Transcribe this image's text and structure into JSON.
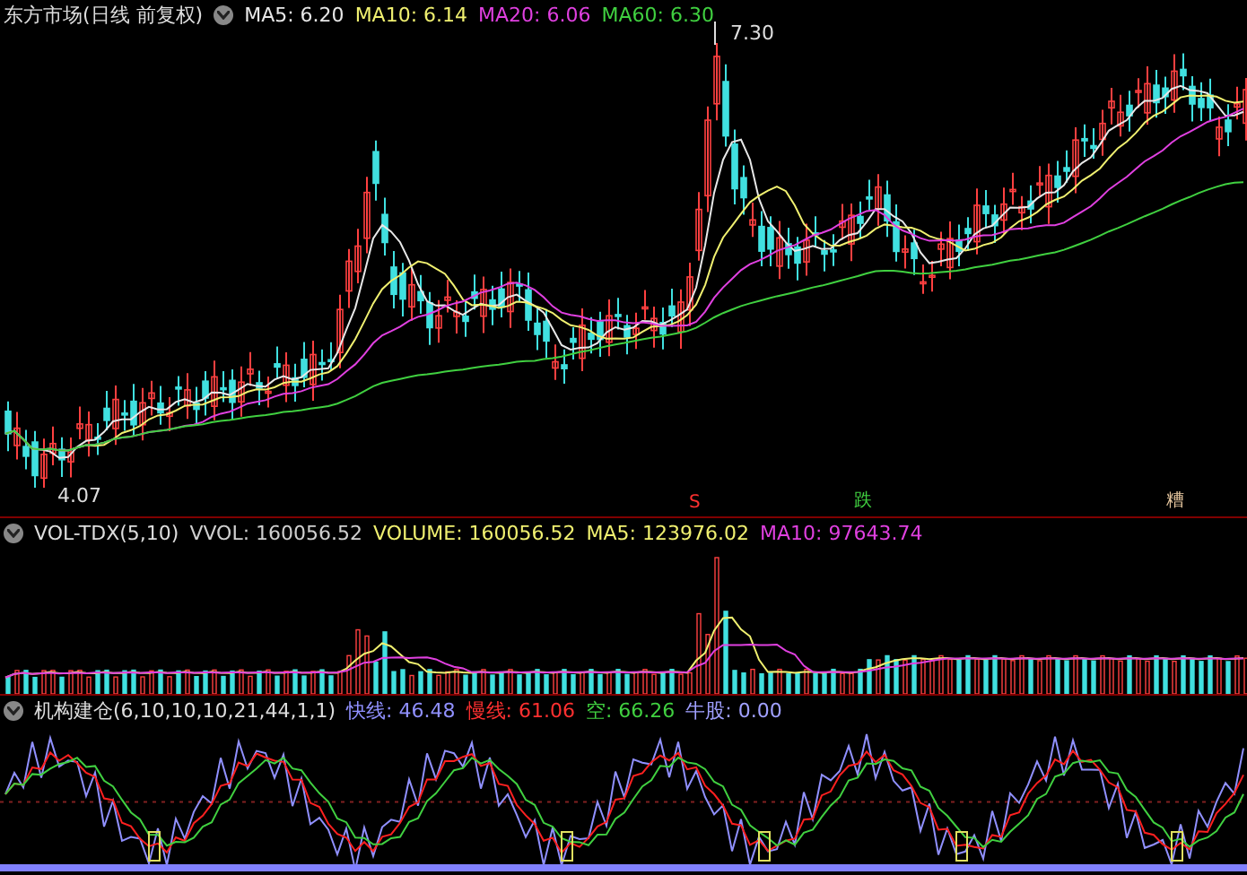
{
  "main_panel": {
    "title": "东方市场(日线 前复权)",
    "indicators": [
      {
        "label": "MA5: 6.20",
        "color": "#e8e8e8"
      },
      {
        "label": "MA10: 6.14",
        "color": "#f0f070"
      },
      {
        "label": "MA20: 6.06",
        "color": "#e040e0"
      },
      {
        "label": "MA60: 6.30",
        "color": "#40d040"
      }
    ],
    "high_label": "7.30",
    "low_label": "4.07",
    "signals": [
      {
        "text": "S",
        "color": "#ff3030"
      },
      {
        "text": "跌",
        "color": "#40d040"
      },
      {
        "text": "糟",
        "color": "#e8c8a0"
      }
    ]
  },
  "volume_panel": {
    "title": "VOL-TDX(5,10)",
    "indicators": [
      {
        "label": "VVOL: 160056.52",
        "color": "#d0d0d0"
      },
      {
        "label": "VOLUME: 160056.52",
        "color": "#f0f070"
      },
      {
        "label": "MA5: 123976.02",
        "color": "#f0f070"
      },
      {
        "label": "MA10: 97643.74",
        "color": "#e040e0"
      }
    ]
  },
  "oscillator_panel": {
    "title": "机构建仓(6,10,10,10,21,44,1,1)",
    "indicators": [
      {
        "label": "快线: 46.48",
        "color": "#9090ff"
      },
      {
        "label": "慢线: 61.06",
        "color": "#ff3030"
      },
      {
        "label": "空: 66.26",
        "color": "#40d040"
      },
      {
        "label": "牛股: 0.00",
        "color": "#a0a0ff"
      }
    ]
  }
}
